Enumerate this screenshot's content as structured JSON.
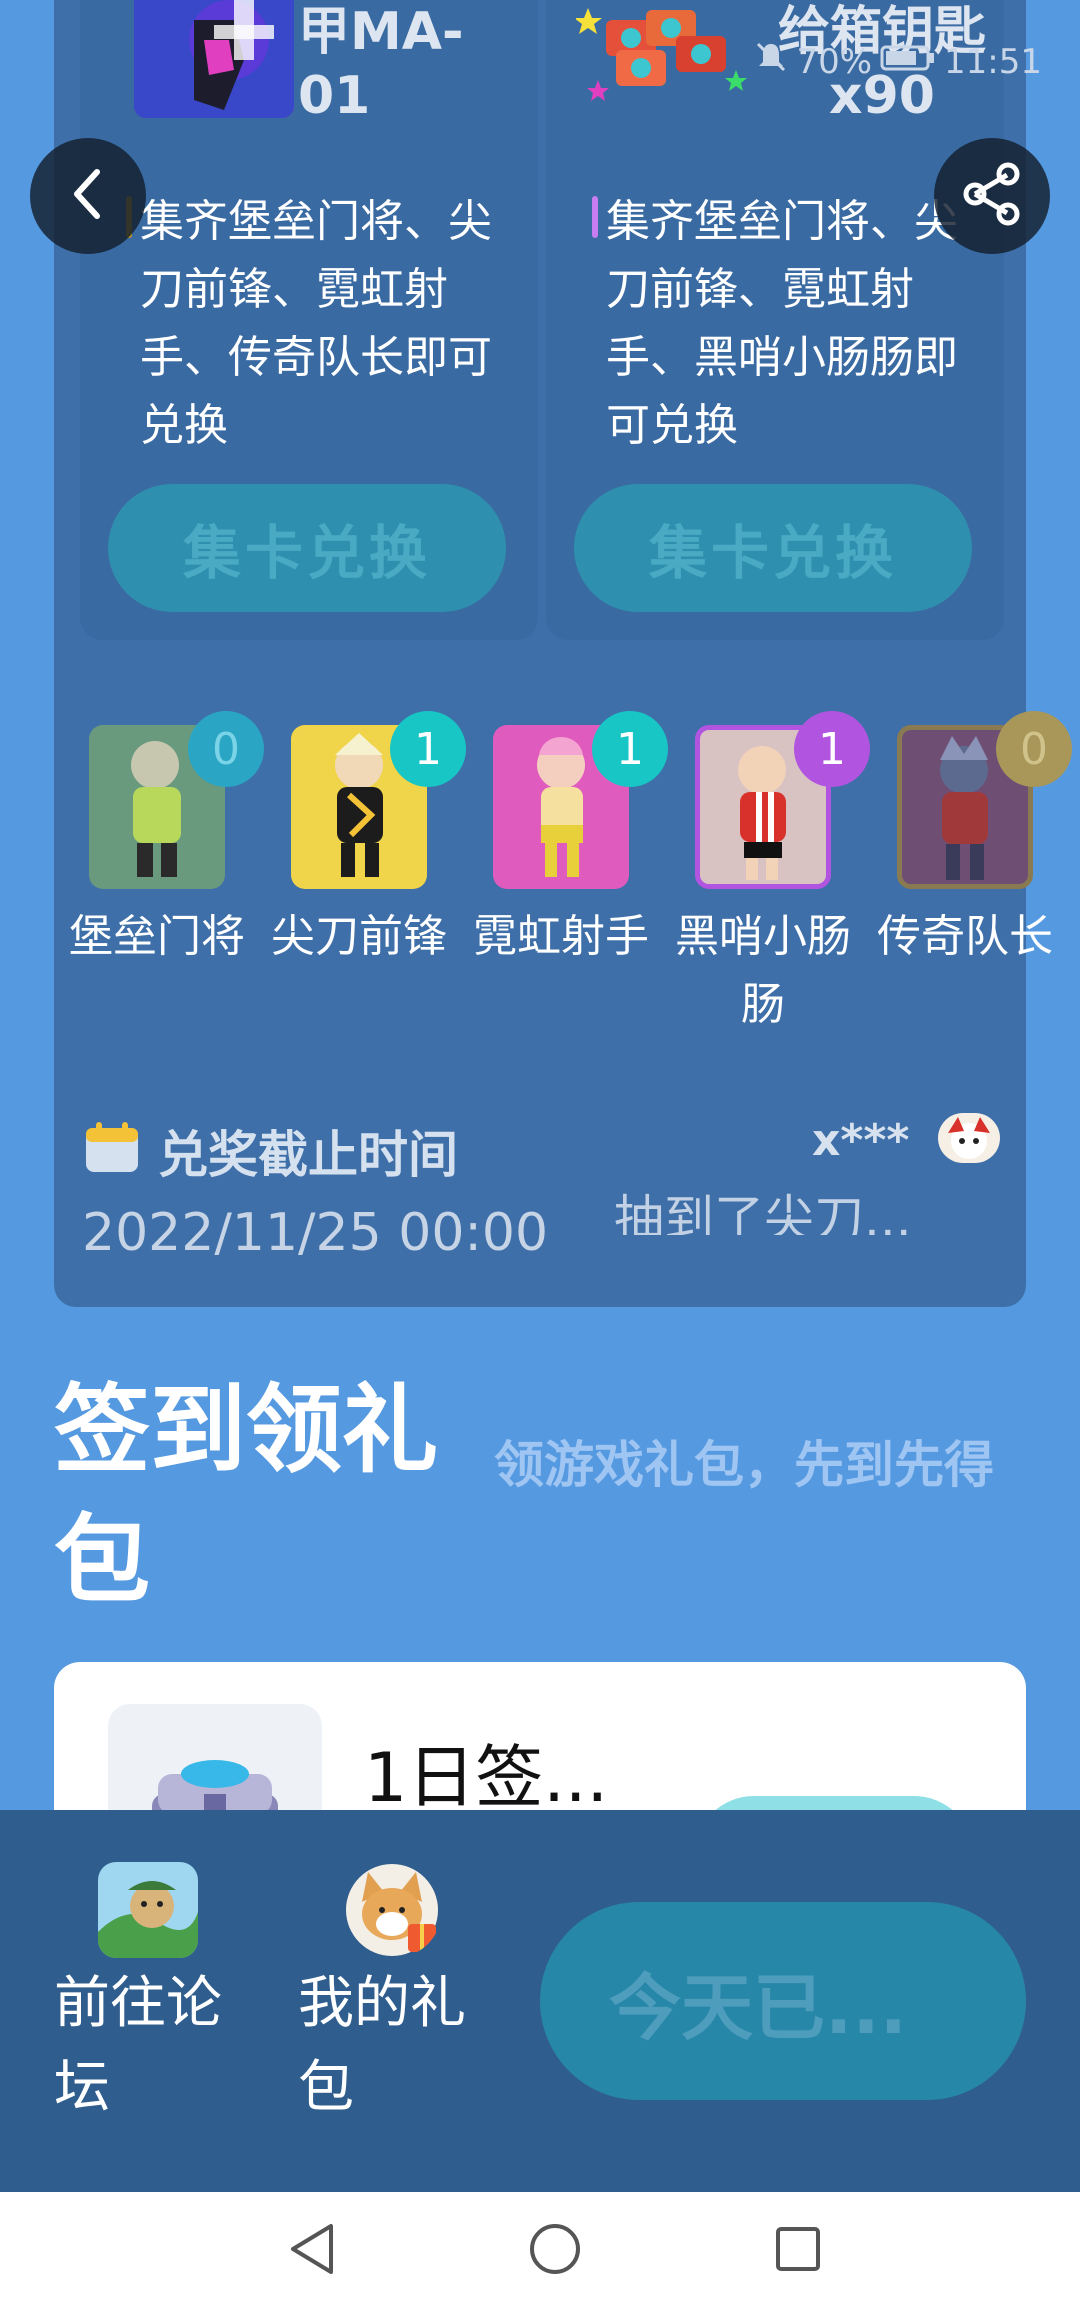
{
  "status_bar": {
    "battery": "70%",
    "time": "11:51"
  },
  "nav": {
    "back": "back",
    "share": "share"
  },
  "exchange_cards": [
    {
      "title": "甲MA-01",
      "description": "集齐堡垒门将、尖刀前锋、霓虹射手、传奇队长即可兑换",
      "button": "集卡兑换"
    },
    {
      "title": "给箱钥匙x90",
      "description": "集齐堡垒门将、尖刀前锋、霓虹射手、黑哨小肠肠即可兑换",
      "button": "集卡兑换"
    }
  ],
  "characters": [
    {
      "name": "堡垒门将",
      "count": "0",
      "badge_color": "#2aa6c4",
      "bg": "#6a9a7e"
    },
    {
      "name": "尖刀前锋",
      "count": "1",
      "badge_color": "#18c6c6",
      "bg": "#f0d44a"
    },
    {
      "name": "霓虹射手",
      "count": "1",
      "badge_color": "#18c6c6",
      "bg": "#e05bbe"
    },
    {
      "name": "黑哨小肠肠",
      "count": "1",
      "badge_color": "#b154e0",
      "bg": "#d9c2c2"
    },
    {
      "name": "传奇队长",
      "count": "0",
      "badge_color": "#a9975a",
      "bg": "#6f4e73"
    }
  ],
  "deadline": {
    "label": "兑奖截止时间",
    "time": "2022/11/25 00:00"
  },
  "ticker": {
    "user": "x***",
    "text": "抽到了尖刀..."
  },
  "sign_in": {
    "title": "签到领礼包",
    "subtitle": "领游戏礼包，先到先得",
    "day_label": "1日签..."
  },
  "bottom": {
    "forum": "前往论坛",
    "gifts": "我的礼包",
    "button": "今天已..."
  }
}
